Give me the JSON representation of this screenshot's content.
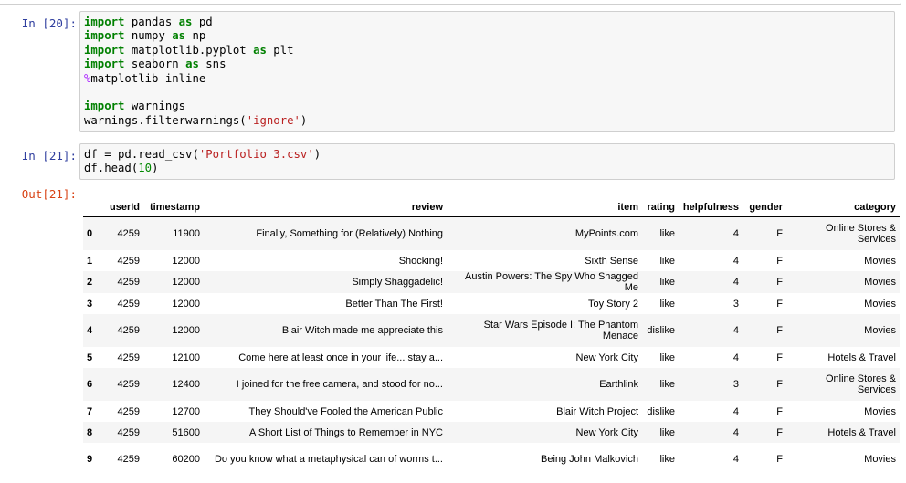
{
  "cells": [
    {
      "prompt": "In [20]:",
      "code_lines": [
        [
          {
            "t": "import",
            "c": "kw"
          },
          {
            "t": " pandas "
          },
          {
            "t": "as",
            "c": "kw"
          },
          {
            "t": " pd"
          }
        ],
        [
          {
            "t": "import",
            "c": "kw"
          },
          {
            "t": " numpy "
          },
          {
            "t": "as",
            "c": "kw"
          },
          {
            "t": " np"
          }
        ],
        [
          {
            "t": "import",
            "c": "kw"
          },
          {
            "t": " matplotlib.pyplot "
          },
          {
            "t": "as",
            "c": "kw"
          },
          {
            "t": " plt"
          }
        ],
        [
          {
            "t": "import",
            "c": "kw"
          },
          {
            "t": " seaborn "
          },
          {
            "t": "as",
            "c": "kw"
          },
          {
            "t": " sns"
          }
        ],
        [
          {
            "t": "%",
            "c": "mg"
          },
          {
            "t": "matplotlib inline"
          }
        ],
        [],
        [
          {
            "t": "import",
            "c": "kw"
          },
          {
            "t": " warnings"
          }
        ],
        [
          {
            "t": "warnings.filterwarnings("
          },
          {
            "t": "'ignore'",
            "c": "str"
          },
          {
            "t": ")"
          }
        ]
      ]
    },
    {
      "prompt": "In [21]:",
      "code_lines": [
        [
          {
            "t": "df = pd.read_csv("
          },
          {
            "t": "'Portfolio 3.csv'",
            "c": "str"
          },
          {
            "t": ")"
          }
        ],
        [
          {
            "t": "df.head("
          },
          {
            "t": "10",
            "c": "num"
          },
          {
            "t": ")"
          }
        ]
      ]
    }
  ],
  "output": {
    "prompt": "Out[21]:",
    "columns": [
      "",
      "userId",
      "timestamp",
      "review",
      "item",
      "rating",
      "helpfulness",
      "gender",
      "category"
    ],
    "rows": [
      [
        "0",
        "4259",
        "11900",
        "Finally, Something for (Relatively) Nothing",
        "MyPoints.com",
        "like",
        "4",
        "F",
        "Online Stores & Services"
      ],
      [
        "1",
        "4259",
        "12000",
        "Shocking!",
        "Sixth Sense",
        "like",
        "4",
        "F",
        "Movies"
      ],
      [
        "2",
        "4259",
        "12000",
        "Simply Shaggadelic!",
        "Austin Powers: The Spy Who Shagged Me",
        "like",
        "4",
        "F",
        "Movies"
      ],
      [
        "3",
        "4259",
        "12000",
        "Better Than The First!",
        "Toy Story 2",
        "like",
        "3",
        "F",
        "Movies"
      ],
      [
        "4",
        "4259",
        "12000",
        "Blair Witch made me appreciate this",
        "Star Wars Episode I: The Phantom Menace",
        "dislike",
        "4",
        "F",
        "Movies"
      ],
      [
        "5",
        "4259",
        "12100",
        "Come here at least once in your life... stay a...",
        "New York City",
        "like",
        "4",
        "F",
        "Hotels & Travel"
      ],
      [
        "6",
        "4259",
        "12400",
        "I joined for the free camera, and stood for no...",
        "Earthlink",
        "like",
        "3",
        "F",
        "Online Stores & Services"
      ],
      [
        "7",
        "4259",
        "12700",
        "They Should've Fooled the American Public",
        "Blair Witch Project",
        "dislike",
        "4",
        "F",
        "Movies"
      ],
      [
        "8",
        "4259",
        "51600",
        "A Short List of Things to Remember in NYC",
        "New York City",
        "like",
        "4",
        "F",
        "Hotels & Travel"
      ],
      [
        "9",
        "4259",
        "60200",
        "Do you know what a metaphysical can of worms t...",
        "Being John Malkovich",
        "like",
        "4",
        "F",
        "Movies"
      ]
    ]
  }
}
